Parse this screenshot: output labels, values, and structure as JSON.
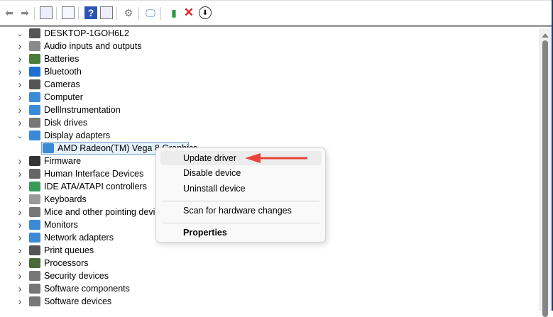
{
  "toolbar": {
    "buttons": [
      "back-icon",
      "forward-icon",
      "show-hide-console-tree-icon",
      "properties-icon",
      "help-icon",
      "action-pane-icon",
      "update-driver-icon",
      "scan-hardware-icon",
      "enable-device-icon",
      "uninstall-icon",
      "disable-device-icon"
    ]
  },
  "tree": {
    "root": "DESKTOP-1GOH6L2",
    "categories": [
      "Audio inputs and outputs",
      "Batteries",
      "Bluetooth",
      "Cameras",
      "Computer",
      "DellInstrumentation",
      "Disk drives",
      "Display adapters",
      "Firmware",
      "Human Interface Devices",
      "IDE ATA/ATAPI controllers",
      "Keyboards",
      "Mice and other pointing devices",
      "Monitors",
      "Network adapters",
      "Print queues",
      "Processors",
      "Security devices",
      "Software components",
      "Software devices"
    ],
    "selected_child": "AMD Radeon(TM) Vega 8 Graphics"
  },
  "context_menu": {
    "items": [
      "Update driver",
      "Disable device",
      "Uninstall device",
      "Scan for hardware changes",
      "Properties"
    ]
  },
  "colors": {
    "arrow": "#e8423a",
    "selection": "#e5f1fb"
  }
}
